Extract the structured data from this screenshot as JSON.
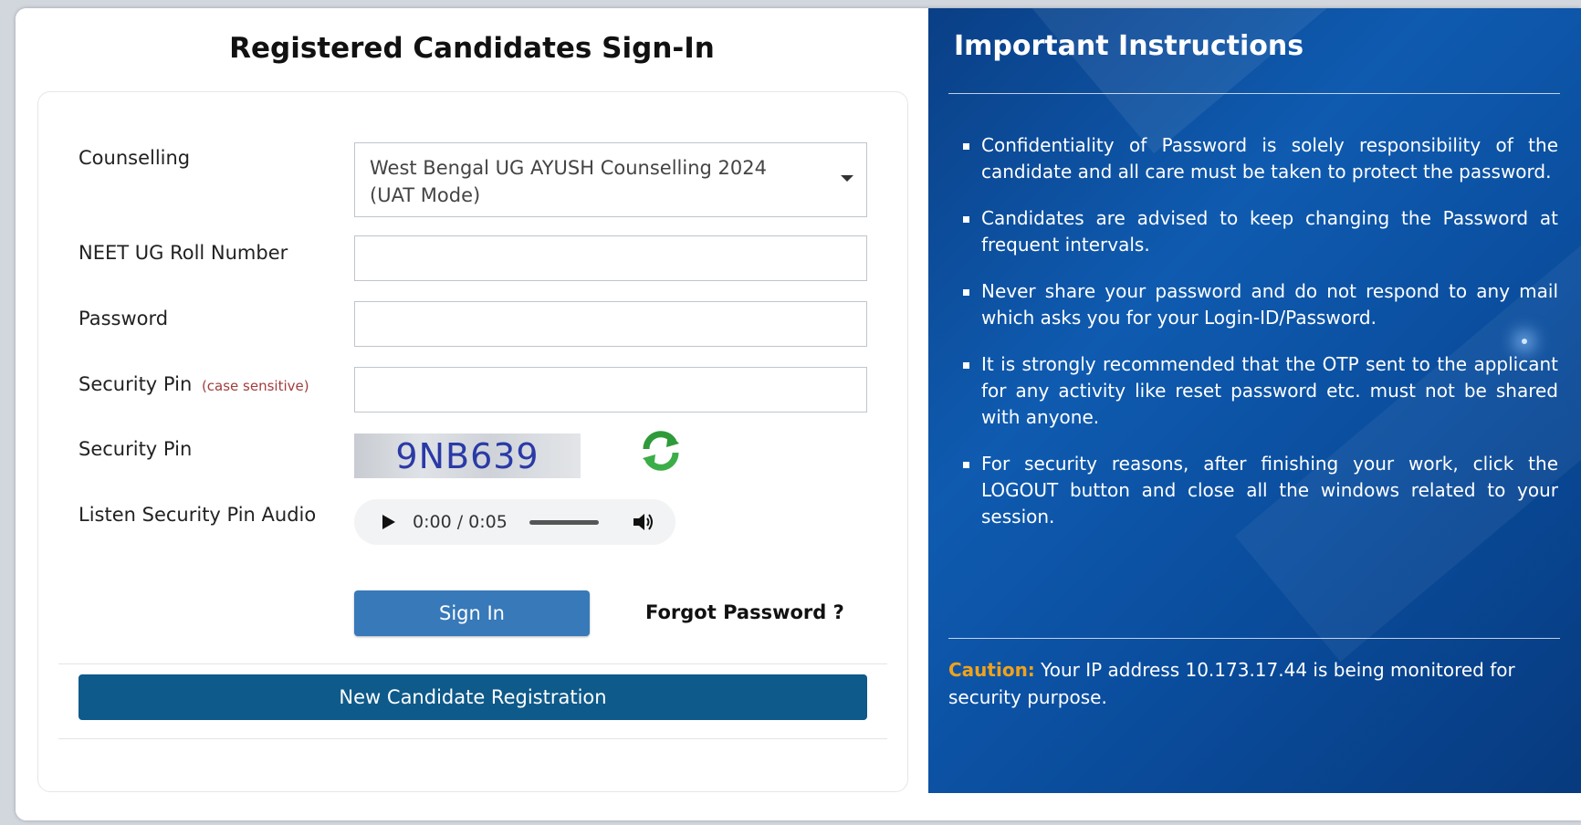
{
  "signin": {
    "title": "Registered Candidates Sign-In",
    "counselling_label": "Counselling",
    "counselling_value": "West Bengal UG AYUSH Counselling 2024 (UAT Mode)",
    "roll_label": "NEET UG Roll Number",
    "password_label": "Password",
    "pin_label": "Security Pin",
    "pin_hint": "(case sensitive)",
    "captcha_label": "Security Pin",
    "captcha_text": "9NB639",
    "audio_label": "Listen Security Pin Audio",
    "audio_time": "0:00 / 0:05",
    "signin_button": "Sign In",
    "forgot_link": "Forgot Password ?",
    "register_button": "New Candidate Registration"
  },
  "instructions": {
    "title": "Important Instructions",
    "items": [
      "Confidentiality of Password is solely responsibility of the candidate and all care must be taken to protect the password.",
      "Candidates are advised to keep changing the Password at frequent intervals.",
      "Never share your password and do not respond to any mail which asks you for your Login-ID/Password.",
      "It is strongly recommended that the OTP sent to the applicant for any activity like reset password etc. must not be shared with anyone.",
      "For security reasons, after finishing your work, click the LOGOUT button and close all the windows related to your session."
    ],
    "caution_label": "Caution:",
    "caution_text": "Your IP address 10.173.17.44 is being monitored for security purpose."
  },
  "colors": {
    "primary_button": "#3779b9",
    "register_button": "#0e5a8a",
    "panel_blue": "#0a4c9c",
    "caution": "#f0a21b",
    "hint": "#a33c3c"
  },
  "icons": {
    "refresh": "refresh-icon",
    "play": "play-icon",
    "volume": "volume-icon",
    "dropdown": "chevron-down-icon"
  }
}
